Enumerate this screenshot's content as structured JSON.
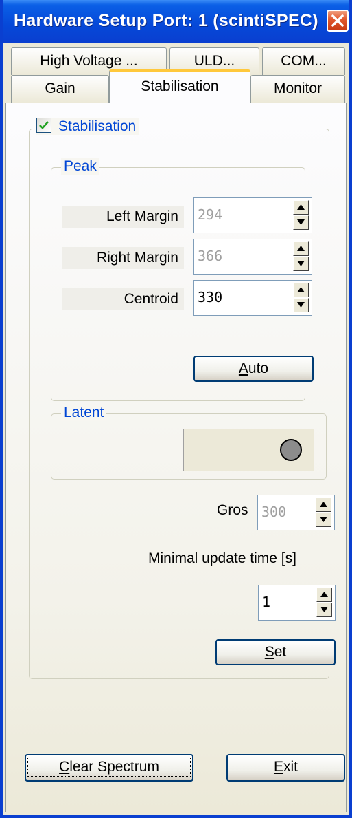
{
  "window": {
    "title": "Hardware Setup Port: 1 (scintiSPEC)"
  },
  "tabs": {
    "row1": [
      {
        "label": "High Voltage ..."
      },
      {
        "label": "ULD..."
      },
      {
        "label": "COM..."
      }
    ],
    "row2": [
      {
        "label": "Gain"
      },
      {
        "label": "Stabilisation",
        "active": true
      },
      {
        "label": "Monitor"
      }
    ]
  },
  "stabilisation": {
    "checkbox_label": "Stabilisation",
    "checked": true,
    "peak": {
      "title": "Peak",
      "left_margin_label": "Left Margin",
      "left_margin_value": "294",
      "right_margin_label": "Right Margin",
      "right_margin_value": "366",
      "centroid_label": "Centroid",
      "centroid_value": "330",
      "auto_button_prefix": "",
      "auto_button_hotkey": "A",
      "auto_button_rest": "uto"
    },
    "latent": {
      "title": "Latent"
    },
    "gros_label": "Gros",
    "gros_value": "300",
    "min_update_label": "Minimal update time [s]",
    "min_update_value": "1",
    "set_button_hotkey": "S",
    "set_button_rest": "et"
  },
  "footer": {
    "clear_hotkey": "C",
    "clear_rest": "lear Spectrum",
    "exit_hotkey": "E",
    "exit_rest": "xit"
  },
  "colors": {
    "titlebar": "#0a3fd0",
    "group_title": "#0046d5",
    "close_button": "#e25a30"
  }
}
